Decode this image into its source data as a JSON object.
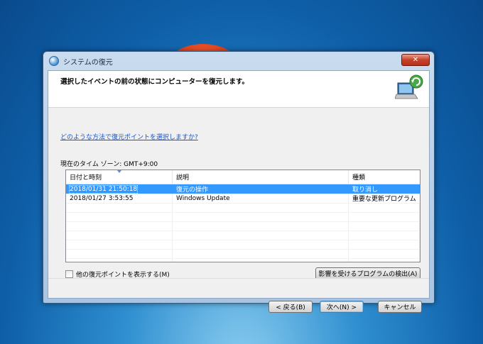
{
  "window": {
    "title": "システムの復元",
    "close_label": "✕"
  },
  "header": {
    "title": "選択したイベントの前の状態にコンピューターを復元します。"
  },
  "help_link": "どのような方法で復元ポイントを選択しますか?",
  "timezone": "現在のタイム ゾーン: GMT+9:00",
  "table": {
    "columns": [
      "日付と時刻",
      "説明",
      "種類"
    ],
    "rows": [
      {
        "date": "2018/01/31 21:50:18",
        "description": "復元の操作",
        "type": "取り消し",
        "selected": true
      },
      {
        "date": "2018/01/27 3:53:55",
        "description": "Windows Update",
        "type": "重要な更新プログラム",
        "selected": false
      }
    ]
  },
  "show_more_checkbox": {
    "label": "他の復元ポイントを表示する(M)",
    "checked": false
  },
  "buttons": {
    "scan_affected": "影響を受けるプログラムの検出(A)",
    "back": "< 戻る(B)",
    "next": "次へ(N) >",
    "cancel": "キャンセル"
  },
  "icons": {
    "title": "system-restore-icon",
    "header": "system-restore-large-icon"
  }
}
